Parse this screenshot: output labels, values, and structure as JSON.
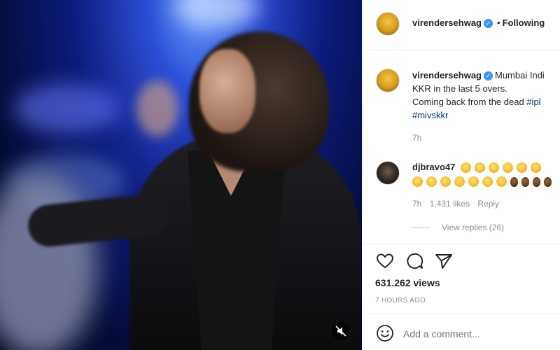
{
  "post": {
    "username": "virendersehwag",
    "follow_status": "Following",
    "caption_lines": [
      "Mumbai Indi",
      "KKR in the last 5 overs.",
      "Coming back from the dead"
    ],
    "hashtags": [
      "#ipl",
      "#mivskkr"
    ],
    "caption_time": "7h",
    "views": "631.262 views",
    "posted_ago": "7 HOURS AGO"
  },
  "comment": {
    "username": "djbravo47",
    "time": "7h",
    "likes": "1,431 likes",
    "reply_label": "Reply",
    "view_replies": "View replies (26)"
  },
  "add_comment": {
    "placeholder": "Add a comment..."
  },
  "icons": {
    "verified": "verified-badge-icon",
    "like": "heart-icon",
    "comment": "comment-bubble-icon",
    "share": "paper-plane-icon",
    "mute": "speaker-muted-icon",
    "emoji": "smiley-icon"
  },
  "colors": {
    "accent": "#3897f0",
    "link": "#00376b",
    "meta": "#8e8e8e"
  }
}
